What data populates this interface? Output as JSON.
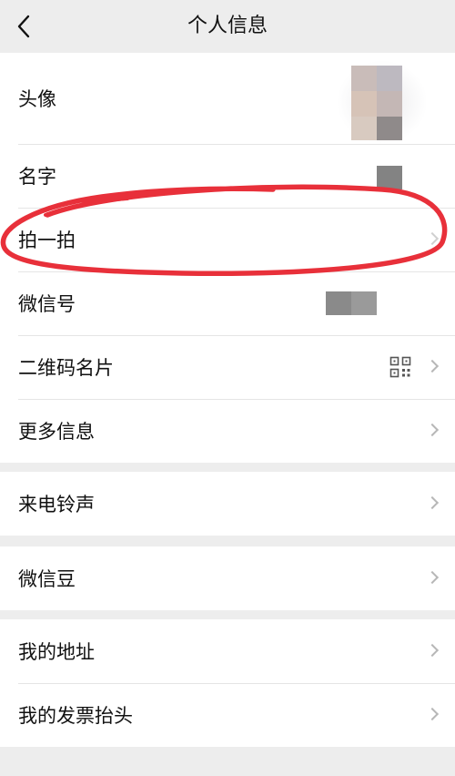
{
  "header": {
    "title": "个人信息"
  },
  "profile": {
    "avatar_label": "头像",
    "name_label": "名字",
    "pat_label": "拍一拍",
    "wechat_id_label": "微信号",
    "qr_label": "二维码名片",
    "more_label": "更多信息"
  },
  "ringtone": {
    "label": "来电铃声"
  },
  "beans": {
    "label": "微信豆"
  },
  "address": {
    "my_address_label": "我的地址",
    "invoice_label": "我的发票抬头"
  },
  "colors": {
    "background": "#ededed",
    "card": "#ffffff",
    "annotation_red": "#e8303a",
    "chevron": "#b7b7b7",
    "mosaic": "#838383"
  },
  "icons": {
    "back": "chevron-left-icon",
    "arrow": "chevron-right-icon",
    "qr": "qr-code-icon"
  }
}
